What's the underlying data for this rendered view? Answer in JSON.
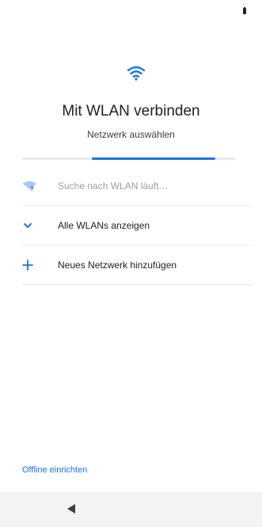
{
  "header": {
    "title": "Mit WLAN verbinden",
    "subtitle": "Netzwerk auswählen"
  },
  "progress": {
    "value_fraction": 0.58
  },
  "list": {
    "items": [
      {
        "label": "Suche nach WLAN läuft…",
        "icon": "wifi-searching-icon",
        "state": "loading"
      },
      {
        "label": "Alle WLANs anzeigen",
        "icon": "chevron-down-icon"
      },
      {
        "label": "Neues Netzwerk hinzufügen",
        "icon": "plus-icon"
      }
    ]
  },
  "footer": {
    "offline_label": "Offline einrichten"
  },
  "nav": {
    "back_icon": "back-triangle-icon"
  },
  "colors": {
    "accent": "#1a73e8",
    "text_primary": "#202124",
    "text_muted": "#9aa0a6",
    "divider": "#ececec",
    "nav_background": "#f1f3f4"
  }
}
